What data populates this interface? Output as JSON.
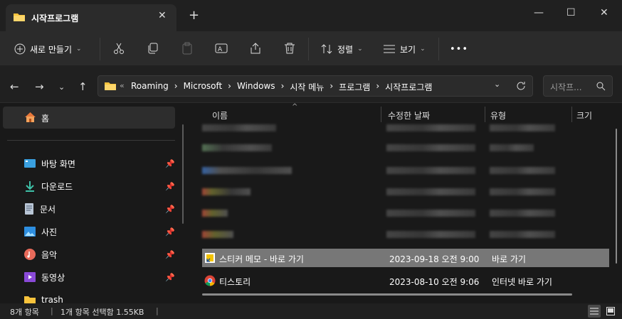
{
  "window": {
    "tab_title": "시작프로그램",
    "tab_close": "✕",
    "new_tab": "+",
    "minimize": "—",
    "maximize": "☐",
    "close": "✕"
  },
  "toolbar": {
    "new_label": "새로 만들기",
    "sort_label": "정렬",
    "view_label": "보기",
    "more_label": "•••"
  },
  "address": {
    "crumbs": [
      "Roaming",
      "Microsoft",
      "Windows",
      "시작 메뉴",
      "프로그램",
      "시작프로그램"
    ],
    "overflow": "«",
    "search_placeholder": "시작프..."
  },
  "sidebar": {
    "home": "홈",
    "items": [
      {
        "label": "바탕 화면",
        "icon": "desktop-icon"
      },
      {
        "label": "다운로드",
        "icon": "download-icon"
      },
      {
        "label": "문서",
        "icon": "document-icon"
      },
      {
        "label": "사진",
        "icon": "pictures-icon"
      },
      {
        "label": "음악",
        "icon": "music-icon"
      },
      {
        "label": "동영상",
        "icon": "video-icon"
      },
      {
        "label": "trash",
        "icon": "folder-icon"
      }
    ]
  },
  "list": {
    "columns": {
      "name": "이름",
      "modified": "수정한 날짜",
      "type": "유형",
      "size": "크기"
    },
    "files": [
      {
        "name": "스티커 메모 - 바로 가기",
        "modified": "2023-09-18 오전 9:00",
        "type": "바로 가기",
        "selected": true
      },
      {
        "name": "티스토리",
        "modified": "2023-08-10 오전 9:06",
        "type": "인터넷 바로 가기",
        "selected": false
      }
    ]
  },
  "status": {
    "count": "8개 항목",
    "selection": "1개 항목 선택함 1.55KB"
  },
  "colors": {
    "accent": "#f8c33c",
    "selected_row": "#777777",
    "bg": "#191919"
  }
}
